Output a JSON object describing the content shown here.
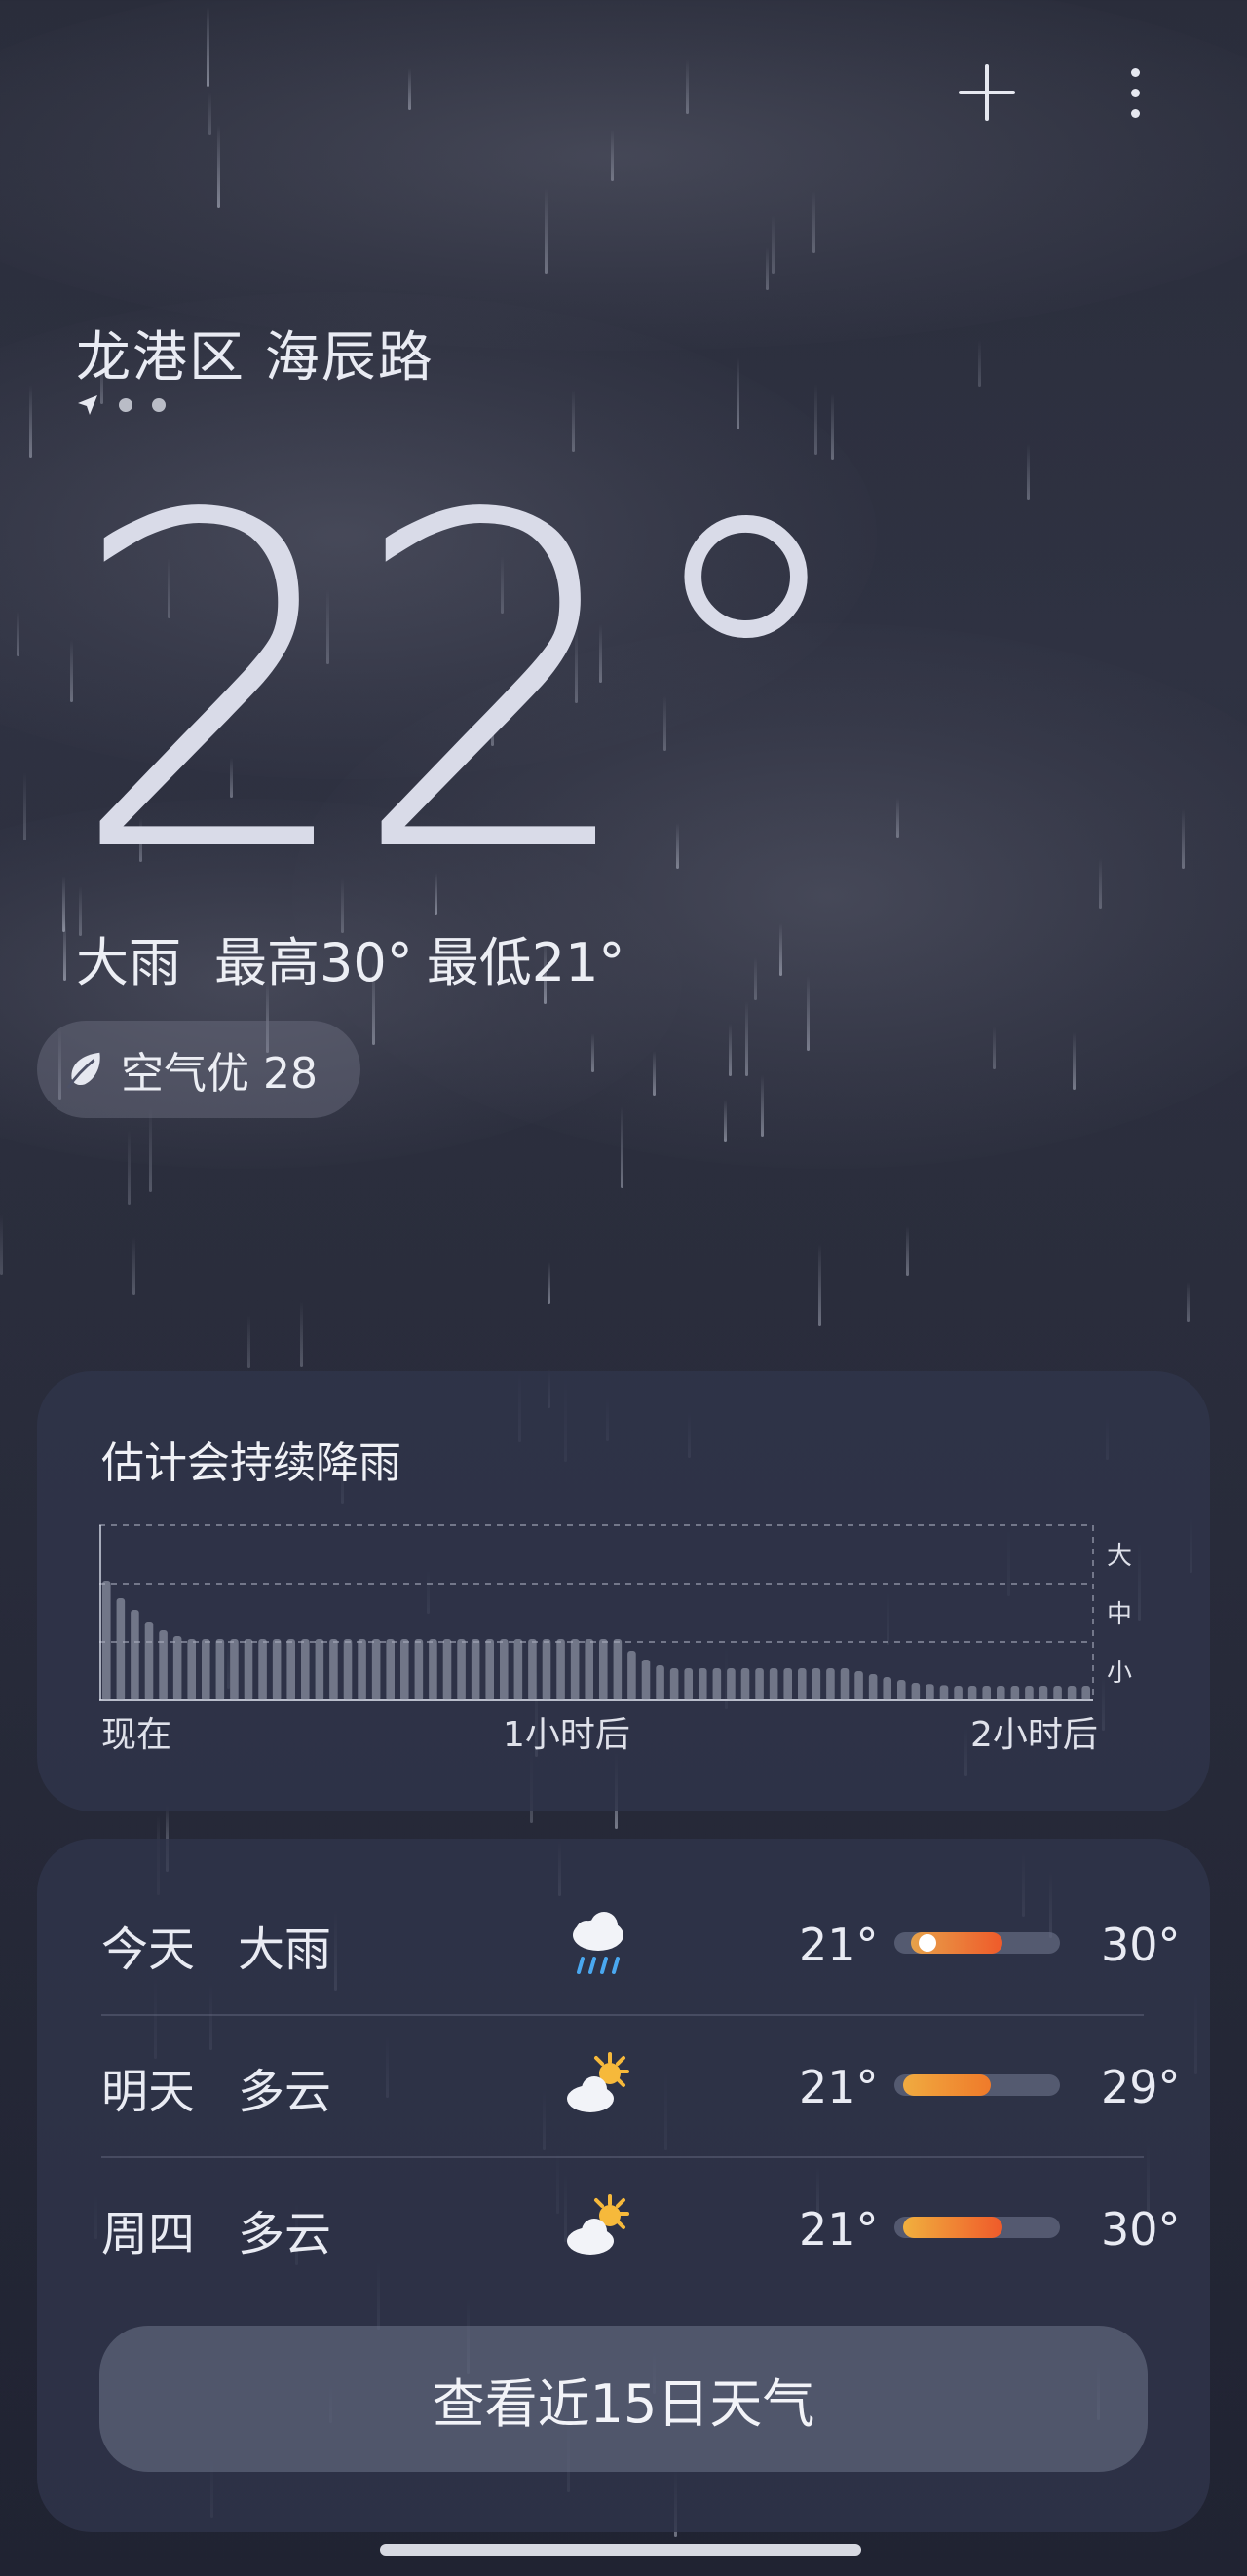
{
  "header": {
    "add_icon": "plus-icon",
    "more_icon": "more-vertical-icon",
    "location": "龙港区 海辰路"
  },
  "current": {
    "temperature": "22°",
    "condition": "大雨",
    "high": "最高30°",
    "low": "最低21°",
    "aqi": "空气优 28",
    "aqi_icon": "leaf-icon"
  },
  "precipitation": {
    "title": "估计会持续降雨",
    "legend": [
      "大",
      "中",
      "小"
    ],
    "x_labels": [
      "现在",
      "1小时后",
      "2小时后"
    ]
  },
  "chart_data": {
    "type": "bar",
    "title": "估计会持续降雨",
    "x_ticks": [
      "现在",
      "1小时后",
      "2小时后"
    ],
    "y_levels": [
      "小",
      "中",
      "大"
    ],
    "ylim": [
      0,
      3
    ],
    "values": [
      2.05,
      1.75,
      1.55,
      1.35,
      1.2,
      1.1,
      1.05,
      1.05,
      1.05,
      1.05,
      1.05,
      1.05,
      1.05,
      1.05,
      1.05,
      1.05,
      1.05,
      1.05,
      1.05,
      1.05,
      1.05,
      1.05,
      1.05,
      1.05,
      1.05,
      1.05,
      1.05,
      1.05,
      1.05,
      1.05,
      1.05,
      1.05,
      1.05,
      1.05,
      1.05,
      1.05,
      1.05,
      0.85,
      0.7,
      0.6,
      0.55,
      0.55,
      0.55,
      0.55,
      0.55,
      0.55,
      0.55,
      0.55,
      0.55,
      0.55,
      0.55,
      0.55,
      0.55,
      0.5,
      0.45,
      0.4,
      0.35,
      0.3,
      0.28,
      0.26,
      0.25,
      0.25,
      0.25,
      0.25,
      0.25,
      0.25,
      0.25,
      0.25,
      0.25,
      0.25
    ]
  },
  "forecast": [
    {
      "day": "今天",
      "condition": "大雨",
      "icon": "heavy-rain-icon",
      "low": "21°",
      "high": "30°",
      "range": [
        0.1,
        0.65
      ],
      "current_marker": 0.2,
      "colors": [
        "#e7a24a",
        "#ef5a2a"
      ]
    },
    {
      "day": "明天",
      "condition": "多云",
      "icon": "partly-cloudy-icon",
      "low": "21°",
      "high": "29°",
      "range": [
        0.05,
        0.58
      ],
      "colors": [
        "#f0ab40",
        "#ef7a2a"
      ]
    },
    {
      "day": "周四",
      "condition": "多云",
      "icon": "partly-cloudy-icon",
      "low": "21°",
      "high": "30°",
      "range": [
        0.05,
        0.65
      ],
      "colors": [
        "#f1b03e",
        "#ef5a2a"
      ]
    }
  ],
  "more_button": "查看近15日天气"
}
